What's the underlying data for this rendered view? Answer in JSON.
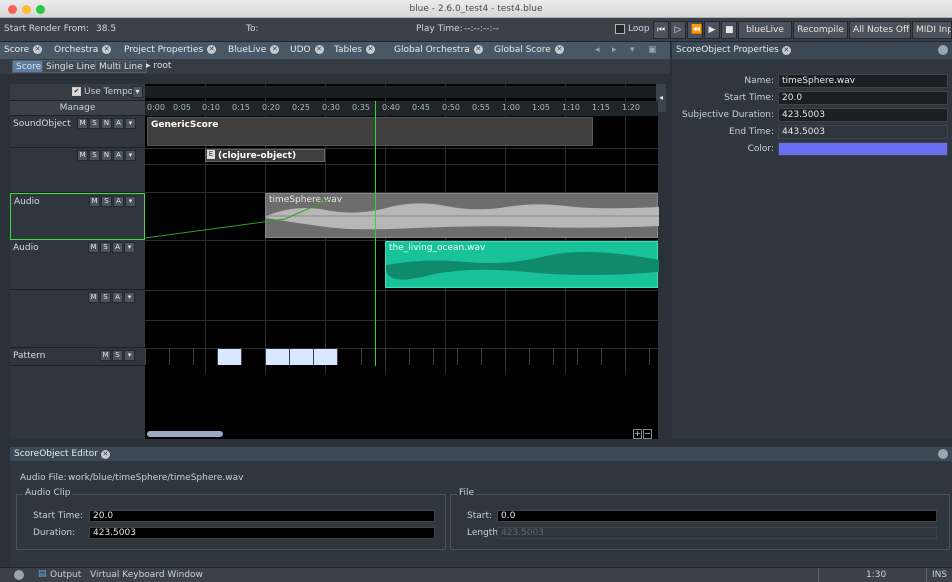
{
  "window": {
    "title": "blue - 2.6.0_test4 - test4.blue"
  },
  "toolbar": {
    "render_from_label": "Start Render From:",
    "render_from_value": "38.5",
    "to_label": "To:",
    "play_time_label": "Play Time:",
    "play_time_value": "--:--:--:--",
    "loop_label": "Loop",
    "bluelive_label": "blueLive",
    "recompile_label": "Recompile",
    "all_notes_off_label": "All Notes Off",
    "midi_input_label": "MIDI Inpu"
  },
  "tabs": [
    "Score",
    "Orchestra",
    "Project Properties",
    "BlueLive",
    "UDO",
    "Tables",
    "Global Orchestra",
    "Global Score"
  ],
  "subtabs": [
    "Score",
    "Single Line",
    "Multi Line"
  ],
  "breadcrumb": "root",
  "lanes_header": {
    "use_tempo": "Use Tempo",
    "manage": "Manage"
  },
  "lanes": [
    {
      "name": "SoundObject",
      "buttons": [
        "M",
        "S",
        "N",
        "A"
      ]
    },
    {
      "name": "",
      "buttons": [
        "M",
        "S",
        "N",
        "A"
      ]
    },
    {
      "name": "Audio",
      "buttons": [
        "M",
        "S",
        "A"
      ]
    },
    {
      "name": "Audio",
      "buttons": [
        "M",
        "S",
        "A"
      ]
    },
    {
      "name": "",
      "buttons": [
        "M",
        "S",
        "A"
      ]
    },
    {
      "name": "Pattern",
      "buttons": [
        "M",
        "S"
      ]
    }
  ],
  "ruler": [
    "0:00",
    "0:05",
    "0:10",
    "0:15",
    "0:20",
    "0:25",
    "0:30",
    "0:35",
    "0:40",
    "0:45",
    "0:50",
    "0:55",
    "1:00",
    "1:05",
    "1:10",
    "1:15",
    "1:20"
  ],
  "blocks": {
    "generic": "GenericScore",
    "clojure": "(clojure-object)",
    "audio1": "timeSphere.wav",
    "audio2": "the_living_ocean.wav"
  },
  "properties": {
    "tab": "ScoreObject Properties",
    "name_label": "Name:",
    "name_value": "timeSphere.wav",
    "start_label": "Start Time:",
    "start_value": "20.0",
    "subj_label": "Subjective Duration:",
    "subj_value": "423.5003",
    "end_label": "End Time:",
    "end_value": "443.5003",
    "color_label": "Color:",
    "color_value": "#6b6ef0"
  },
  "editor": {
    "tab": "ScoreObject Editor",
    "audio_file_label": "Audio File:",
    "audio_file_value": "work/blue/timeSphere/timeSphere.wav",
    "clip_legend": "Audio Clip",
    "file_legend": "File",
    "clip_start_label": "Start Time:",
    "clip_start_value": "20.0",
    "clip_duration_label": "Duration:",
    "clip_duration_value": "423.5003",
    "file_start_label": "Start:",
    "file_start_value": "0.0",
    "file_length_label": "Length:",
    "file_length_value": "423.5003"
  },
  "status": {
    "output": "Output",
    "vkw": "Virtual Keyboard Window",
    "position": "1:30",
    "mode": "INS"
  }
}
